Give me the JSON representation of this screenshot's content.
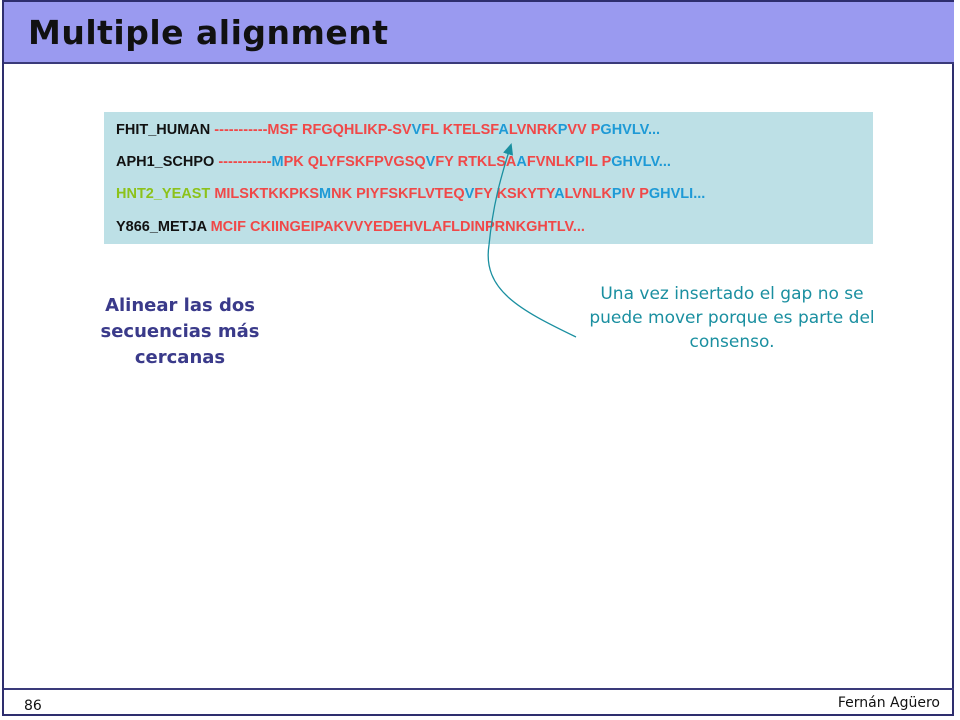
{
  "slide": {
    "title": "Multiple alignment",
    "page_number": "86",
    "author": "Fernán Agüero"
  },
  "colors": {
    "title_bg": "#9a9af0",
    "alignment_bg": "#bde0e6",
    "red": "#f04848",
    "blue": "#1e9ad6",
    "green": "#8cc21a",
    "black": "#111111",
    "note_blue": "#3a3a8a",
    "note_teal": "#1a8fa0"
  },
  "alignment": {
    "rows": [
      {
        "segments": [
          {
            "text": "FHIT_HUMAN ",
            "color": "black"
          },
          {
            "text": "-----------MSF RFGQHLIKP-SV",
            "color": "red"
          },
          {
            "text": "V",
            "color": "blue"
          },
          {
            "text": "FL KTELSF",
            "color": "red"
          },
          {
            "text": "A",
            "color": "blue"
          },
          {
            "text": "LVNRK",
            "color": "red"
          },
          {
            "text": "P",
            "color": "blue"
          },
          {
            "text": "VV ",
            "color": "red"
          },
          {
            "text": "P",
            "color": "red"
          },
          {
            "text": "GHVLV...",
            "color": "blue"
          }
        ]
      },
      {
        "segments": [
          {
            "text": "APH1_SCHPO ",
            "color": "black"
          },
          {
            "text": "-----------",
            "color": "red"
          },
          {
            "text": "M",
            "color": "blue"
          },
          {
            "text": "PK QLYFSKFPVGSQ",
            "color": "red"
          },
          {
            "text": "V",
            "color": "blue"
          },
          {
            "text": "FY RTKLSA",
            "color": "red"
          },
          {
            "text": "A",
            "color": "blue"
          },
          {
            "text": "FVNLK",
            "color": "red"
          },
          {
            "text": "P",
            "color": "blue"
          },
          {
            "text": "IL ",
            "color": "red"
          },
          {
            "text": "P",
            "color": "red"
          },
          {
            "text": "GHVLV...",
            "color": "blue"
          }
        ]
      },
      {
        "segments": [
          {
            "text": "HNT2_YEAST ",
            "color": "green"
          },
          {
            "text": "MILSKTKKPKS",
            "color": "red"
          },
          {
            "text": "M",
            "color": "blue"
          },
          {
            "text": "NK PIYFSKFLVTEQ",
            "color": "red"
          },
          {
            "text": "V",
            "color": "blue"
          },
          {
            "text": "FY KSKYTY",
            "color": "red"
          },
          {
            "text": "A",
            "color": "blue"
          },
          {
            "text": "LVNLK",
            "color": "red"
          },
          {
            "text": "P",
            "color": "blue"
          },
          {
            "text": "IV ",
            "color": "red"
          },
          {
            "text": "P",
            "color": "red"
          },
          {
            "text": "GHVLI...",
            "color": "blue"
          }
        ]
      },
      {
        "segments": [
          {
            "text": "Y866_METJA ",
            "color": "black"
          },
          {
            "text": "MCIF CKIINGEIPAKVVYEDEHVLAFLDINPRNKGHTLV...",
            "color": "red"
          }
        ]
      }
    ]
  },
  "notes": {
    "left": "Alinear las dos secuencias más cercanas",
    "right": "Una vez insertado el gap no se puede mover porque es parte del consenso."
  }
}
